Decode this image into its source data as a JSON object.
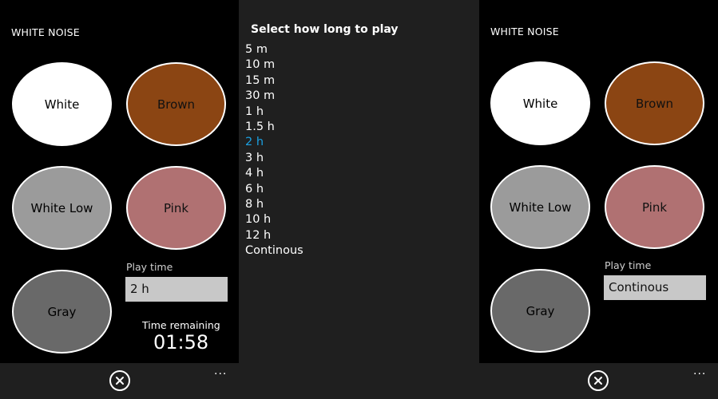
{
  "left": {
    "app_title": "WHITE NOISE",
    "sounds": [
      "White",
      "Brown",
      "White Low",
      "Pink",
      "Gray"
    ],
    "play_time_label": "Play time",
    "play_time_value": "2 h",
    "time_remaining_label": "Time remaining",
    "time_remaining_value": "01:58",
    "appbar": {
      "stop_icon": "close-circle-icon",
      "more": "..."
    }
  },
  "picker": {
    "title": "Select how long to play",
    "options": [
      "5 m",
      "10 m",
      "15 m",
      "30 m",
      "1 h",
      "1.5 h",
      "2 h",
      "3 h",
      "4 h",
      "6 h",
      "8 h",
      "10 h",
      "12 h",
      "Continous"
    ],
    "selected": "2 h",
    "accent_color": "#1ba1e2"
  },
  "right": {
    "app_title": "WHITE NOISE",
    "sounds": [
      "White",
      "Brown",
      "White Low",
      "Pink",
      "Gray"
    ],
    "play_time_label": "Play time",
    "play_time_value": "Continous",
    "appbar": {
      "stop_icon": "close-circle-icon",
      "more": "..."
    }
  },
  "colors": {
    "white": "#ffffff",
    "brown": "#8b4513",
    "white_low": "#9b9b9b",
    "pink": "#b07172",
    "gray": "#696969"
  }
}
